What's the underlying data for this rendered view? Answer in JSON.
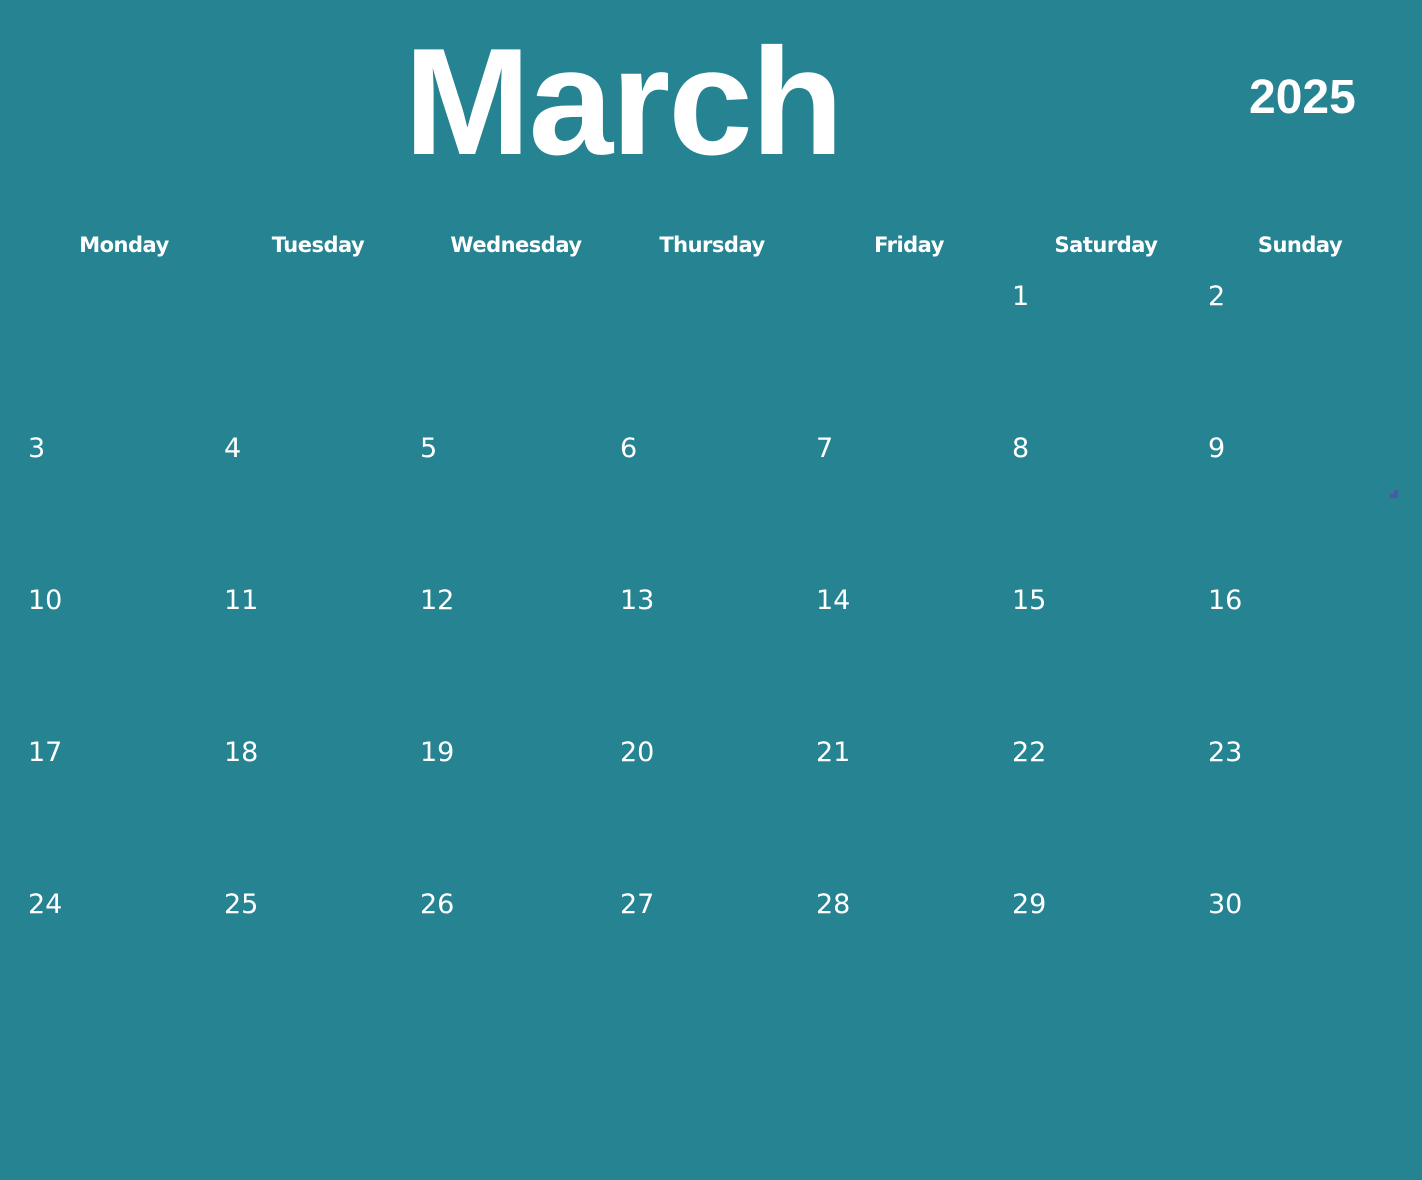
{
  "header": {
    "month": "March",
    "year": "2025"
  },
  "weekdays": [
    "Monday",
    "Tuesday",
    "Wednesday",
    "Thursday",
    "Friday",
    "Saturday",
    "Sunday"
  ],
  "weeks": [
    [
      "",
      "",
      "",
      "",
      "",
      "1",
      "2"
    ],
    [
      "3",
      "4",
      "5",
      "6",
      "7",
      "8",
      "9"
    ],
    [
      "10",
      "11",
      "12",
      "13",
      "14",
      "15",
      "16"
    ],
    [
      "17",
      "18",
      "19",
      "20",
      "21",
      "22",
      "23"
    ],
    [
      "24",
      "25",
      "26",
      "27",
      "28",
      "29",
      "30"
    ]
  ],
  "colors": {
    "background": "#268392",
    "text": "#ffffff"
  }
}
